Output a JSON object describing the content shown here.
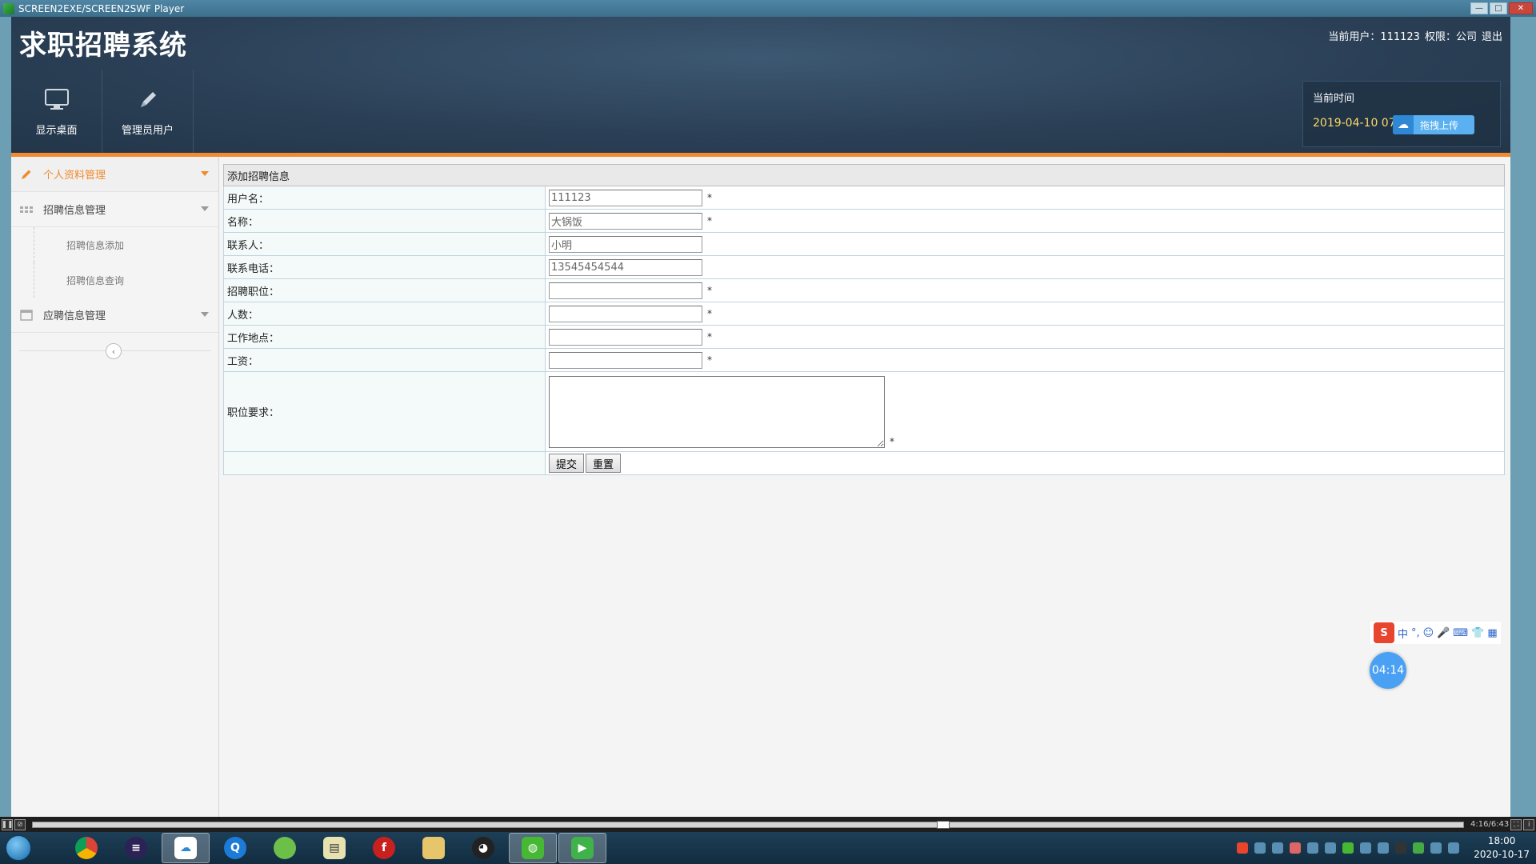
{
  "player": {
    "title": "SCREEN2EXE/SCREEN2SWF Player",
    "time": "4:16/6:43"
  },
  "app": {
    "title": "求职招聘系统",
    "user": {
      "current_user_label": "当前用户：111123",
      "role_label": "权限：公司",
      "logout": "退出"
    },
    "nav": [
      {
        "label": "显示桌面",
        "icon": "monitor-icon"
      },
      {
        "label": "管理员用户",
        "icon": "pencil-icon"
      }
    ],
    "time_box": {
      "label": "当前时间",
      "value": "2019-04-10 07:",
      "upload_label": "拖拽上传"
    }
  },
  "sidebar": {
    "groups": [
      {
        "label": "个人资料管理",
        "active": true
      },
      {
        "label": "招聘信息管理",
        "active": false
      },
      {
        "label": "应聘信息管理",
        "active": false
      }
    ],
    "subitems": [
      "招聘信息添加",
      "招聘信息查询"
    ]
  },
  "form": {
    "title": "添加招聘信息",
    "fields": [
      {
        "label": "用户名：",
        "value": "111123",
        "required": "*"
      },
      {
        "label": "名称：",
        "value": "大锅饭",
        "required": "*"
      },
      {
        "label": "联系人：",
        "value": "小明",
        "required": ""
      },
      {
        "label": "联系电话：",
        "value": "13545454544",
        "required": ""
      },
      {
        "label": "招聘职位：",
        "value": "",
        "required": "*"
      },
      {
        "label": "人数：",
        "value": "",
        "required": "*"
      },
      {
        "label": "工作地点：",
        "value": "",
        "required": "*"
      },
      {
        "label": "工资：",
        "value": "",
        "required": "*"
      }
    ],
    "requirements": {
      "label": "职位要求：",
      "required": "*"
    },
    "submit": "提交",
    "reset": "重置"
  },
  "widgets": {
    "ime_label": "中",
    "timer": "04:14"
  },
  "taskbar": {
    "clock_time": "18:00",
    "clock_date": "2020-10-17"
  }
}
